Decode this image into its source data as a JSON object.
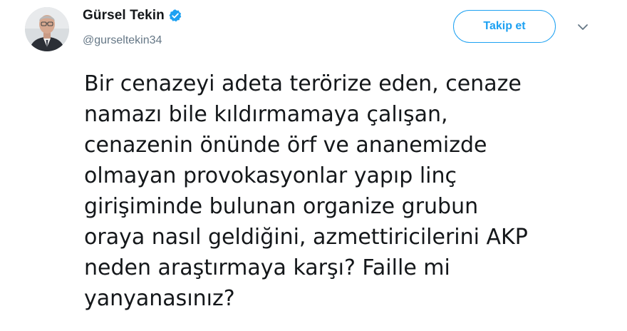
{
  "author": {
    "display_name": "Gürsel Tekin",
    "handle": "@gurseltekin34",
    "verified": true,
    "avatar_icon": "profile-photo"
  },
  "actions": {
    "follow_label": "Takip et",
    "more_icon": "chevron-down-icon"
  },
  "tweet": {
    "lines": [
      "Bir cenazeyi adeta terörize eden, cenaze",
      "namazı bile kıldırmamaya çalışan,",
      "cenazenin önünde örf ve ananemizde",
      "olmayan provokasyonlar yapıp linç",
      "girişiminde bulunan organize grubun",
      "oraya nasıl geldiğini, azmettiricilerini AKP",
      "neden araştırmaya karşı? Faille mi",
      "yanyanasınız?"
    ]
  },
  "colors": {
    "accent": "#1da1f2",
    "text": "#14171a",
    "secondary": "#657786"
  }
}
